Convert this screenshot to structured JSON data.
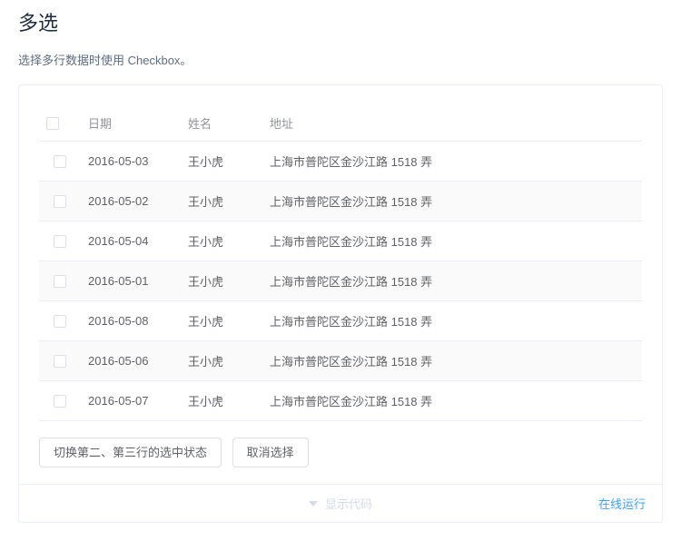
{
  "section": {
    "title": "多选",
    "description": "选择多行数据时使用 Checkbox。"
  },
  "table": {
    "headers": {
      "date": "日期",
      "name": "姓名",
      "address": "地址"
    },
    "rows": [
      {
        "date": "2016-05-03",
        "name": "王小虎",
        "address": "上海市普陀区金沙江路 1518 弄"
      },
      {
        "date": "2016-05-02",
        "name": "王小虎",
        "address": "上海市普陀区金沙江路 1518 弄"
      },
      {
        "date": "2016-05-04",
        "name": "王小虎",
        "address": "上海市普陀区金沙江路 1518 弄"
      },
      {
        "date": "2016-05-01",
        "name": "王小虎",
        "address": "上海市普陀区金沙江路 1518 弄"
      },
      {
        "date": "2016-05-08",
        "name": "王小虎",
        "address": "上海市普陀区金沙江路 1518 弄"
      },
      {
        "date": "2016-05-06",
        "name": "王小虎",
        "address": "上海市普陀区金沙江路 1518 弄"
      },
      {
        "date": "2016-05-07",
        "name": "王小虎",
        "address": "上海市普陀区金沙江路 1518 弄"
      }
    ]
  },
  "buttons": {
    "toggle": "切换第二、第三行的选中状态",
    "clear": "取消选择"
  },
  "footer": {
    "show_code": "显示代码",
    "run_online": "在线运行"
  }
}
